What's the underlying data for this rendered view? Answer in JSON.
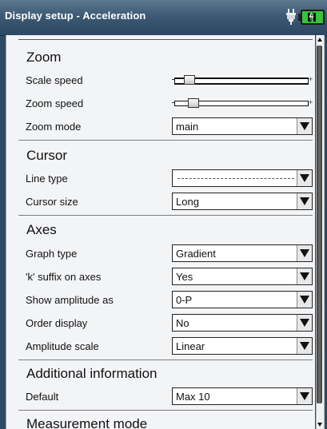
{
  "window": {
    "title": "Display setup - Acceleration"
  },
  "status_icons": [
    "plug-icon",
    "battery-icon"
  ],
  "sections": {
    "zoom": {
      "title": "Zoom",
      "scale_speed": {
        "label": "Scale speed",
        "level": 0.12
      },
      "zoom_speed": {
        "label": "Zoom speed",
        "level": 0.12
      },
      "zoom_mode": {
        "label": "Zoom mode",
        "value": "main"
      }
    },
    "cursor": {
      "title": "Cursor",
      "line_type": {
        "label": "Line type",
        "value_style": "dashed"
      },
      "cursor_size": {
        "label": "Cursor size",
        "value": "Long"
      }
    },
    "axes": {
      "title": "Axes",
      "graph_type": {
        "label": "Graph type",
        "value": "Gradient"
      },
      "k_suffix": {
        "label": "'k' suffix on axes",
        "value": "Yes"
      },
      "show_amplitude": {
        "label": "Show amplitude as",
        "value": "0-P"
      },
      "order_display": {
        "label": "Order display",
        "value": "No"
      },
      "amplitude_scale": {
        "label": "Amplitude scale",
        "value": "Linear"
      }
    },
    "additional": {
      "title": "Additional information",
      "default": {
        "label": "Default",
        "value": "Max 10"
      }
    },
    "measurement": {
      "title": "Measurement mode"
    }
  },
  "colors": {
    "title_bar": "#3d5a74",
    "panel_bg": "#f3f4f6",
    "battery_green": "#39c23a"
  }
}
